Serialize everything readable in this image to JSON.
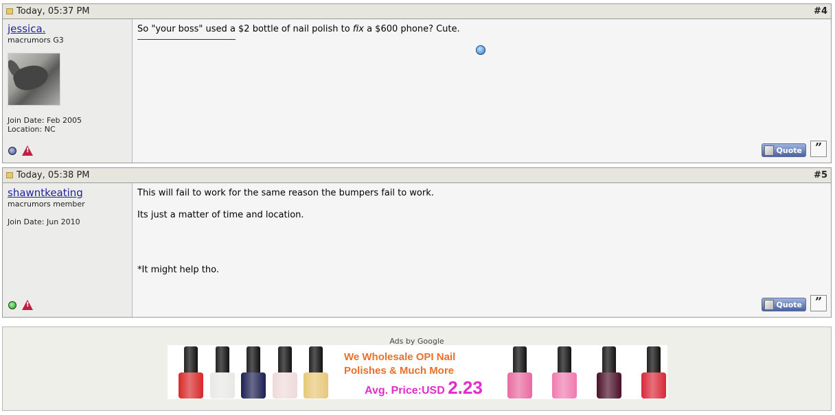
{
  "posts": [
    {
      "date": "Today, 05:37 PM",
      "number": "#4",
      "username": "jessica.",
      "usertitle": "macrumors G3",
      "join_date": "Join Date: Feb 2005",
      "location": "Location: NC",
      "status": "offline",
      "message": [
        "So \"your boss\" used a $2 bottle of nail polish to ",
        "fix",
        " a $600 phone? Cute."
      ],
      "quote_label": "Quote"
    },
    {
      "date": "Today, 05:38 PM",
      "number": "#5",
      "username": "shawntkeating",
      "usertitle": "macrumors member",
      "join_date": "Join Date: Jun 2010",
      "status": "online",
      "message_lines": [
        "This will fail to work for the same reason the bumpers fail to work.",
        "Its just a matter of time and location.",
        "*It might help tho."
      ],
      "quote_label": "Quote"
    }
  ],
  "ads": {
    "label": "Ads by Google",
    "headline_1": "We Wholesale OPI Nail",
    "headline_2": "Polishes & Much More",
    "price_label": "Avg. Price:USD ",
    "price_value": "2.23",
    "colors": {
      "headline": "#e8702a",
      "price": "#e22ccc"
    },
    "bottle_colors": [
      "#d82828",
      "#e8e8e6",
      "#1c2050",
      "#eedada",
      "#e8c878",
      "#e86aa0",
      "#f07ab0",
      "#4a1028",
      "#d82838"
    ]
  },
  "icons": {
    "post_icon": "post-icon",
    "smiley": "smiley-icon",
    "warning": "warning-icon",
    "online": "online-status-icon",
    "offline": "offline-status-icon",
    "multiquote": "multiquote-icon"
  }
}
